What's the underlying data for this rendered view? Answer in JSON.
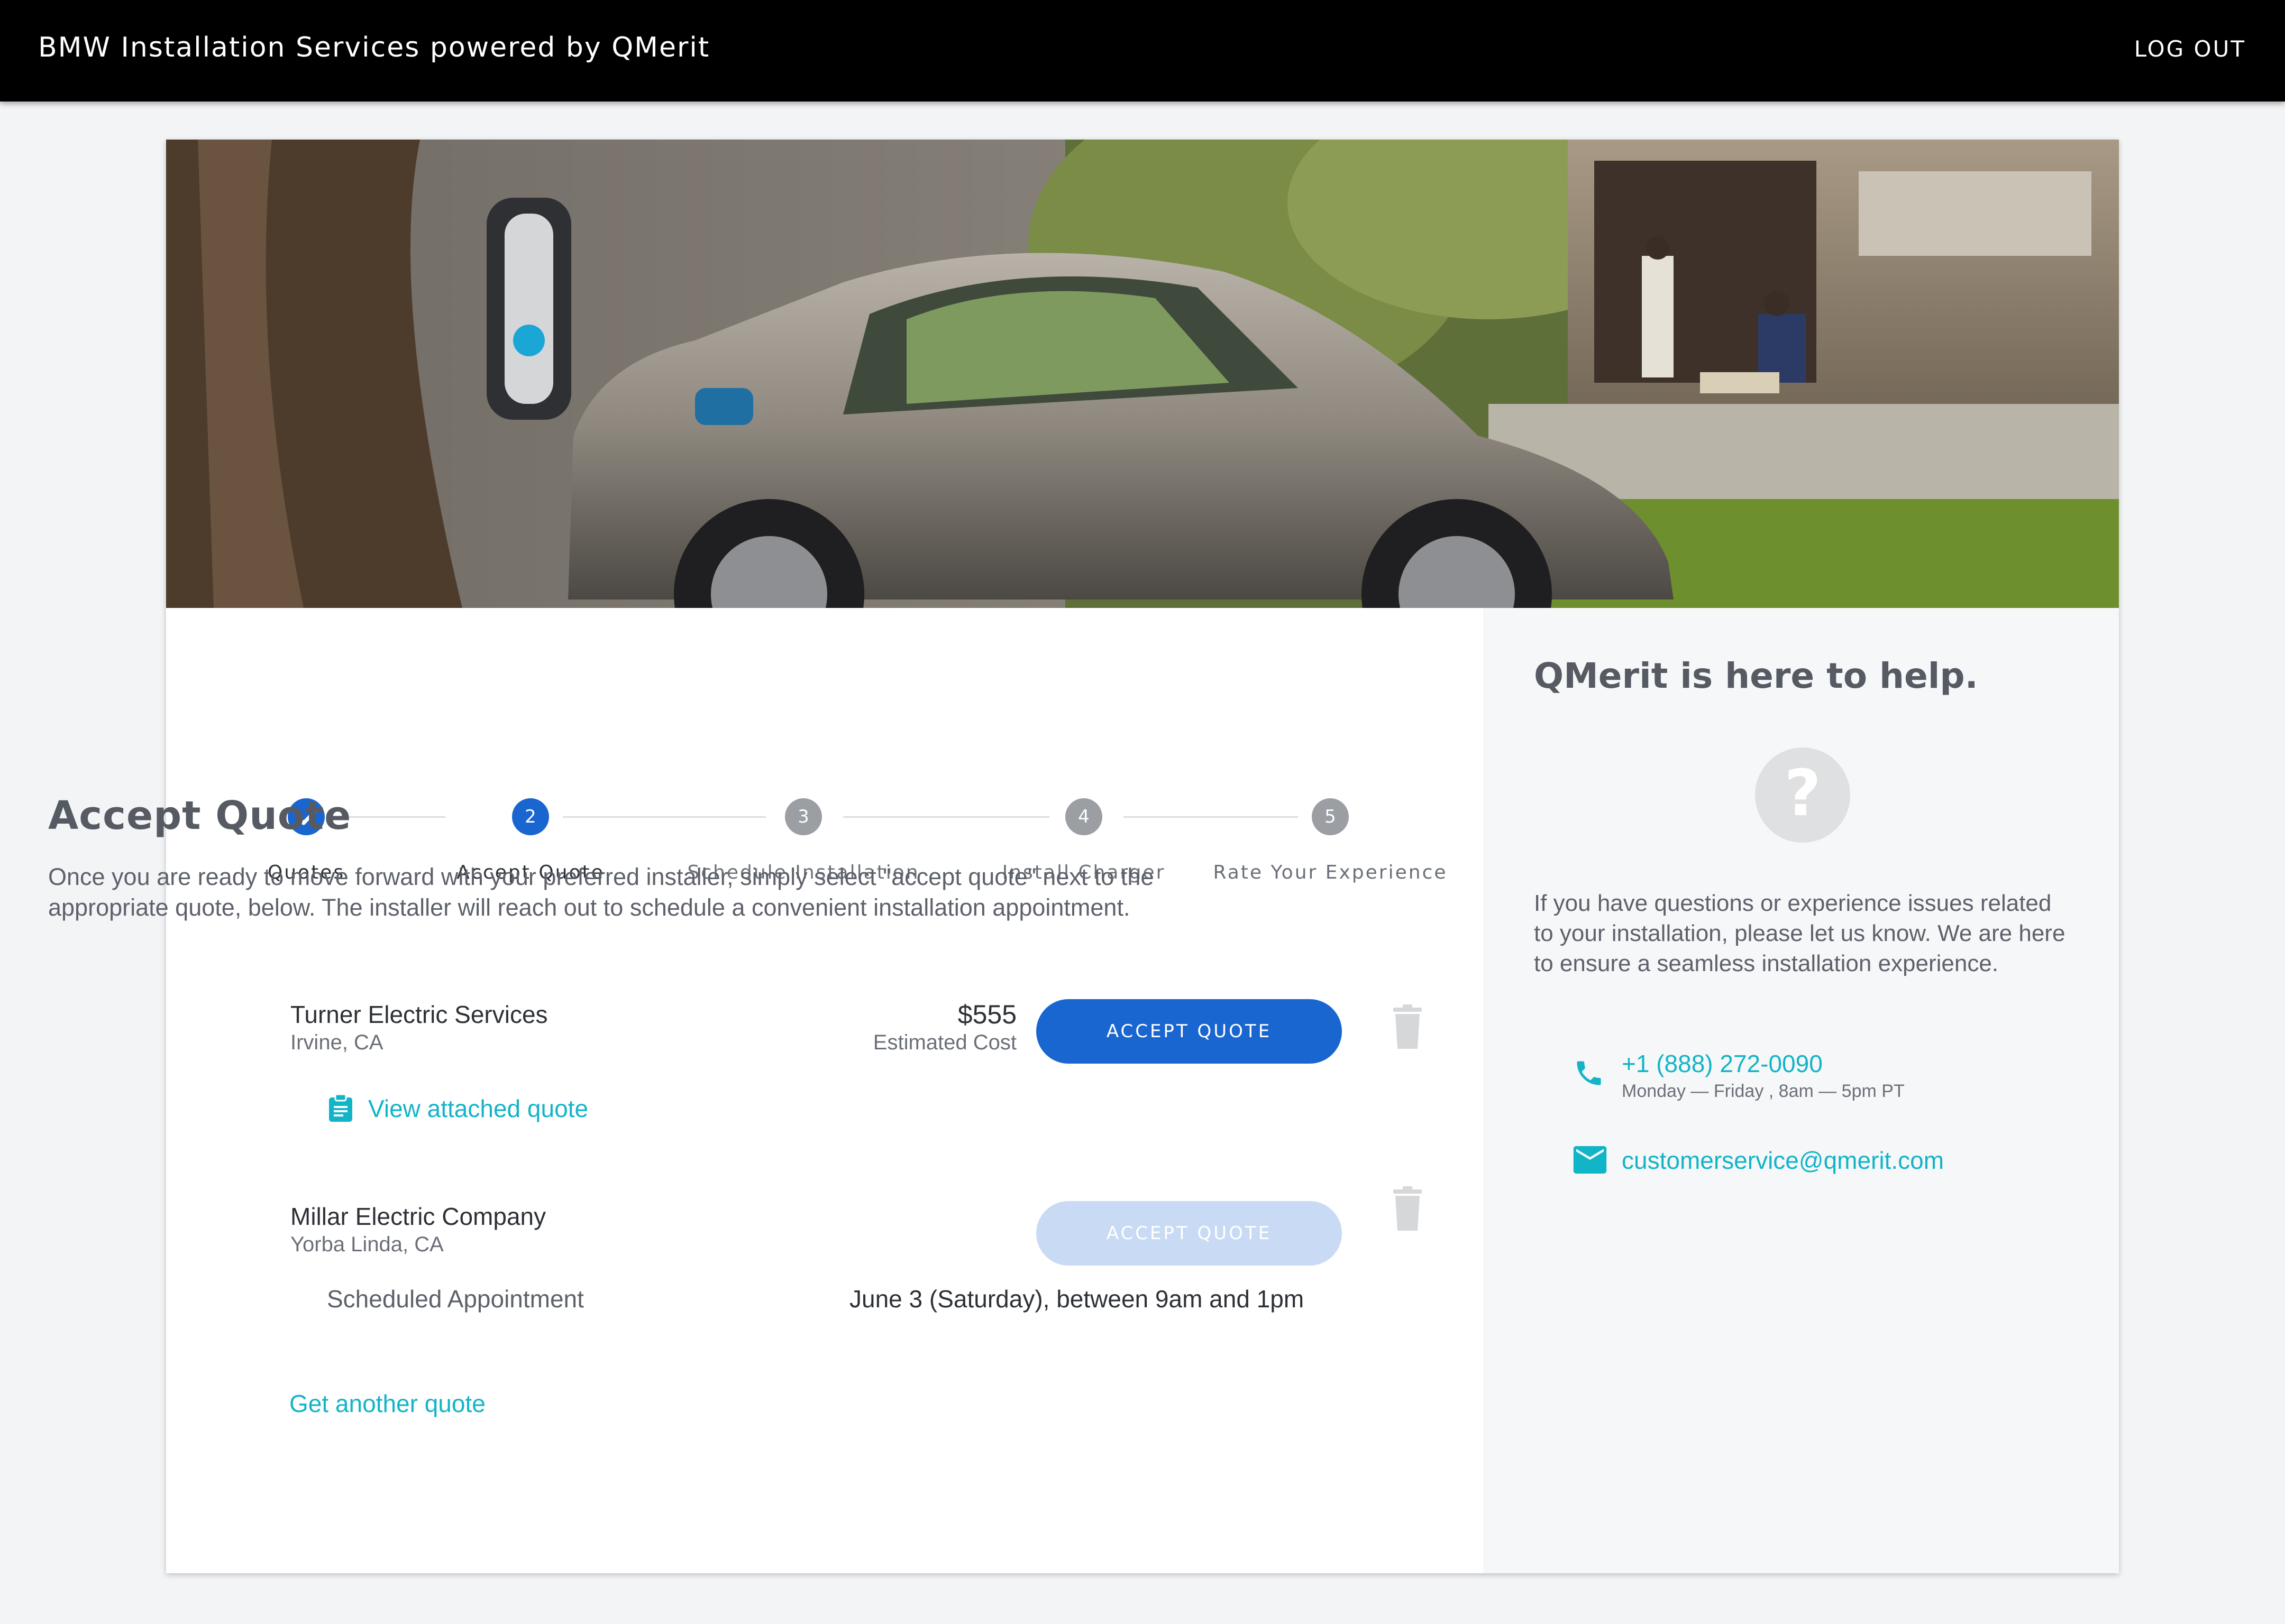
{
  "header": {
    "title": "BMW Installation Services powered by QMerit",
    "logout_label": "LOG OUT"
  },
  "steps": [
    {
      "label": "Quotes",
      "number": "",
      "status": "complete"
    },
    {
      "label": "Accept Quote",
      "number": "2",
      "status": "current"
    },
    {
      "label": "Schedule Installation",
      "number": "3",
      "status": "upcoming"
    },
    {
      "label": "Install Charger",
      "number": "4",
      "status": "upcoming"
    },
    {
      "label": "Rate Your Experience",
      "number": "5",
      "status": "upcoming"
    }
  ],
  "main": {
    "title": "Accept Quote",
    "intro": "Once you are ready to move forward with your preferred installer, simply select \"accept quote\" next to the appropriate quote, below. The installer will reach out to schedule a convenient installation appointment.",
    "quotes": [
      {
        "name": "Turner Electric Services",
        "location": "Irvine, CA",
        "price": "$555",
        "price_label": "Estimated Cost",
        "button_label": "ACCEPT QUOTE",
        "button_enabled": true,
        "attachment_link": "View attached quote"
      },
      {
        "name": "Millar Electric Company",
        "location": "Yorba Linda, CA",
        "button_label": "ACCEPT QUOTE",
        "button_enabled": false,
        "appointment_label": "Scheduled Appointment",
        "appointment_value": "June 3 (Saturday), between 9am and 1pm"
      }
    ],
    "another_quote_link": "Get another quote"
  },
  "help": {
    "title": "QMerit is here to help.",
    "text": "If you have questions or experience issues related to your installation, please let us know. We are here to ensure a seamless installation experience.",
    "phone": "+1 (888) 272-0090",
    "hours": "Monday — Friday ,  8am — 5pm   PT",
    "email": "customerservice@qmerit.com"
  },
  "colors": {
    "primary": "#1a66d1",
    "link": "#12b4c8",
    "step_inactive": "#9b9ea3",
    "topbar": "#000000"
  },
  "icons": [
    "check-icon",
    "clipboard-icon",
    "trash-icon",
    "question-icon",
    "phone-icon",
    "mail-icon"
  ]
}
